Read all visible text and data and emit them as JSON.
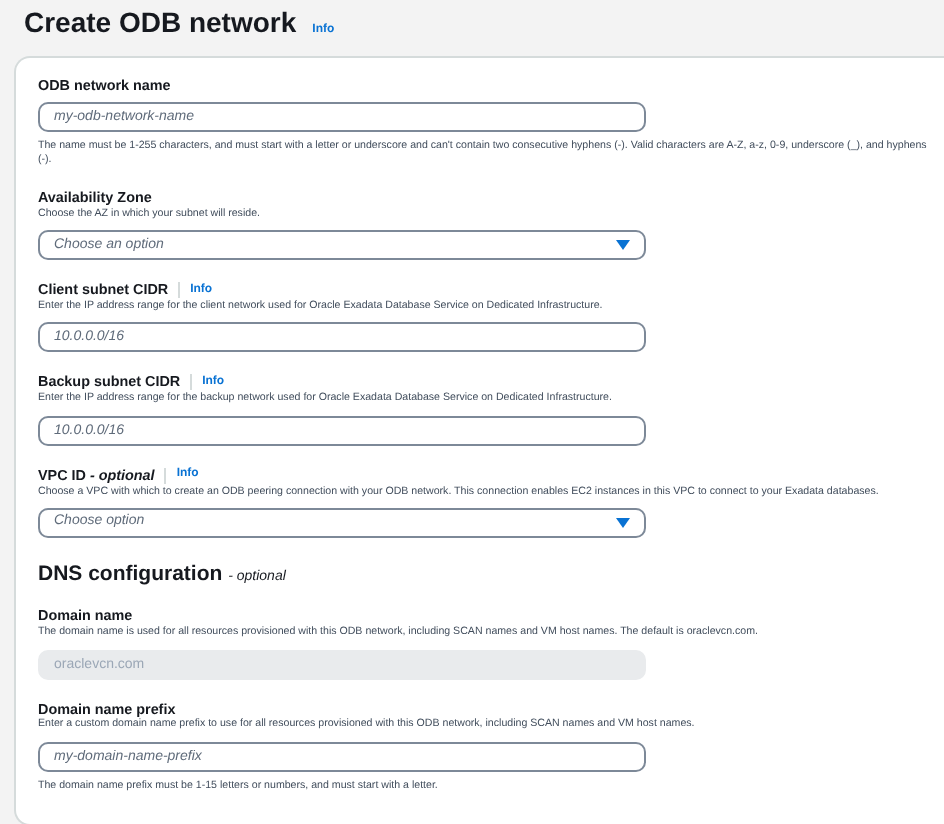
{
  "page": {
    "title": "Create ODB network",
    "info": "Info"
  },
  "fields": [
    {
      "kind": "text",
      "label": "ODB network name",
      "placeholder": "my-odb-network-name",
      "hint": "The name must be 1-255 characters, and must start with a letter or underscore and can't contain two consecutive hyphens (-). Valid characters are A-Z, a-z, 0-9, underscore (_), and hyphens (-)."
    },
    {
      "kind": "select",
      "label": "Availability Zone",
      "description": "Choose the AZ in which your subnet will reside.",
      "placeholder": "Choose an option"
    },
    {
      "kind": "text",
      "label": "Client subnet CIDR",
      "info": "Info",
      "description": "Enter the IP address range for the client network used for Oracle Exadata Database Service on Dedicated Infrastructure.",
      "placeholder": "10.0.0.0/16"
    },
    {
      "kind": "text",
      "label": "Backup subnet CIDR",
      "info": "Info",
      "description": "Enter the IP address range for the backup network used for Oracle Exadata Database Service on Dedicated Infrastructure.",
      "placeholder": "10.0.0.0/16"
    },
    {
      "kind": "select",
      "label": "VPC ID",
      "optional": "- optional",
      "info": "Info",
      "description": "Choose a VPC with which to create an ODB peering connection with your ODB network. This connection enables EC2 instances in this VPC to connect to your Exadata databases.",
      "placeholder": "Choose option"
    }
  ],
  "dns": {
    "heading": "DNS configuration",
    "optional": "- optional",
    "fields": [
      {
        "kind": "disabled",
        "label": "Domain name",
        "description": "The domain name is used for all resources provisioned with this ODB network, including SCAN names and VM host names. The default is oraclevcn.com.",
        "value": "oraclevcn.com"
      },
      {
        "kind": "text",
        "label": "Domain name prefix",
        "description": "Enter a custom domain name prefix to use for all resources provisioned with this ODB network, including SCAN names and VM host names.",
        "placeholder": "my-domain-name-prefix",
        "hint": "The domain name prefix must be 1-15 letters or numbers, and must start with a letter."
      }
    ]
  }
}
